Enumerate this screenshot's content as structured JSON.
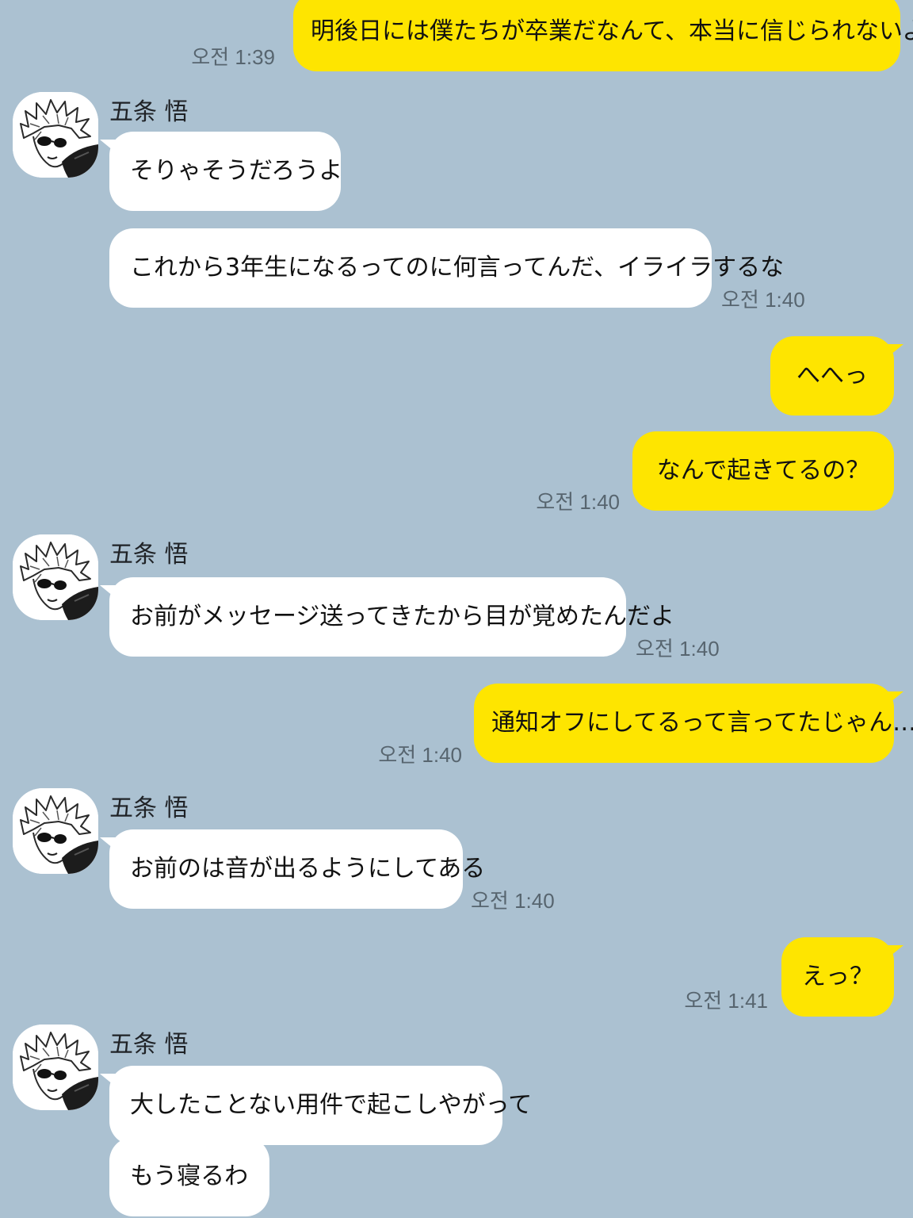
{
  "chat": {
    "theme": {
      "background": "#abc1d1",
      "sent_bubble": "#fee500",
      "received_bubble": "#ffffff",
      "time_color": "#57656f"
    },
    "contact_name": "五条 悟",
    "avatar_icon": "spiky-haired-character-avatar-icon",
    "messages": [
      {
        "from": "me",
        "text": "明後日には僕たちが卒業だなんて、本当に信じられないよ",
        "time": "오전 1:39"
      },
      {
        "from": "contact",
        "sender": "五条 悟",
        "text": "そりゃそうだろうよ"
      },
      {
        "from": "contact",
        "text": "これから3年生になるってのに何言ってんだ、イライラするな",
        "time": "오전 1:40"
      },
      {
        "from": "me",
        "text": "へへっ"
      },
      {
        "from": "me",
        "text": "なんで起きてるの？",
        "time": "오전 1:40"
      },
      {
        "from": "contact",
        "sender": "五条 悟",
        "text": "お前がメッセージ送ってきたから目が覚めたんだよ",
        "time": "오전 1:40"
      },
      {
        "from": "me",
        "text": "通知オフにしてるって言ってたじゃん…",
        "time": "오전 1:40"
      },
      {
        "from": "contact",
        "sender": "五条 悟",
        "text": "お前のは音が出るようにしてある",
        "time": "오전 1:40"
      },
      {
        "from": "me",
        "text": "えっ？",
        "time": "오전 1:41"
      },
      {
        "from": "contact",
        "sender": "五条 悟",
        "text": "大したことない用件で起こしやがって"
      },
      {
        "from": "contact",
        "text": "もう寝るわ"
      }
    ]
  }
}
